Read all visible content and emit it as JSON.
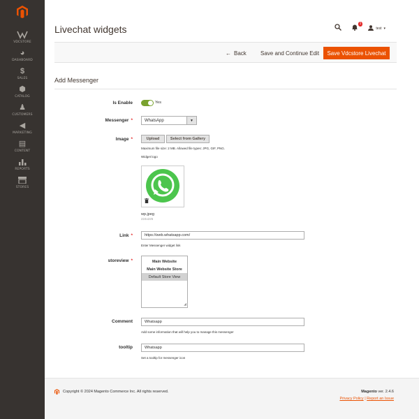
{
  "sidebar": {
    "items": [
      {
        "label": "VDCSTORE",
        "icon": "vdcstore-logo-icon"
      },
      {
        "label": "DASHBOARD",
        "icon": "dashboard-icon"
      },
      {
        "label": "SALES",
        "icon": "dollar-icon"
      },
      {
        "label": "CATALOG",
        "icon": "cube-icon"
      },
      {
        "label": "CUSTOMERS",
        "icon": "person-icon"
      },
      {
        "label": "MARKETING",
        "icon": "megaphone-icon"
      },
      {
        "label": "CONTENT",
        "icon": "layout-icon"
      },
      {
        "label": "REPORTS",
        "icon": "bar-chart-icon"
      },
      {
        "label": "STORES",
        "icon": "store-icon"
      }
    ]
  },
  "header": {
    "title": "Livechat widgets",
    "notification_count": "1",
    "user_name": "test"
  },
  "actions": {
    "back_label": "Back",
    "continue_label": "Save and Continue Edit",
    "save_label": "Save Vdcstore Livechat"
  },
  "section": {
    "title": "Add Messenger"
  },
  "form": {
    "is_enable": {
      "label": "Is Enable",
      "value": "Yes"
    },
    "messenger": {
      "label": "Messenger",
      "value": "WhatsApp"
    },
    "image": {
      "label": "Image",
      "upload_label": "Upload",
      "gallery_label": "Select from Gallery",
      "note": "Maximum file size: 2 MB. Allowed file types: JPG, GIF, PNG.",
      "sub_note": "Widget logo",
      "file_name": "wp.jpeg",
      "file_dims": "224x225"
    },
    "link": {
      "label": "Link",
      "value": "https://web.whatsapp.com/",
      "note": "Enter Messenger widget link"
    },
    "storeview": {
      "label": "storeview",
      "options": [
        "Main Website",
        "Main Website Store",
        "Default Store View"
      ]
    },
    "comment": {
      "label": "Comment",
      "value": "Whatsapp",
      "note": "Add some information that will help you to manage this messenger"
    },
    "tooltip": {
      "label": "tooltip",
      "value": "Whatsapp",
      "note": "Set a tooltip for messenger icon"
    }
  },
  "footer": {
    "copyright": "Copyright © 2024 Magento Commerce Inc. All rights reserved.",
    "brand": "Magento",
    "version": "ver. 2.4.6",
    "privacy": "Privacy Policy",
    "separator": "|",
    "report": "Report an Issue"
  },
  "colors": {
    "accent": "#eb5202",
    "sidebar": "#373330",
    "toggle_on": "#79a22e",
    "whatsapp": "#4cc54d"
  }
}
